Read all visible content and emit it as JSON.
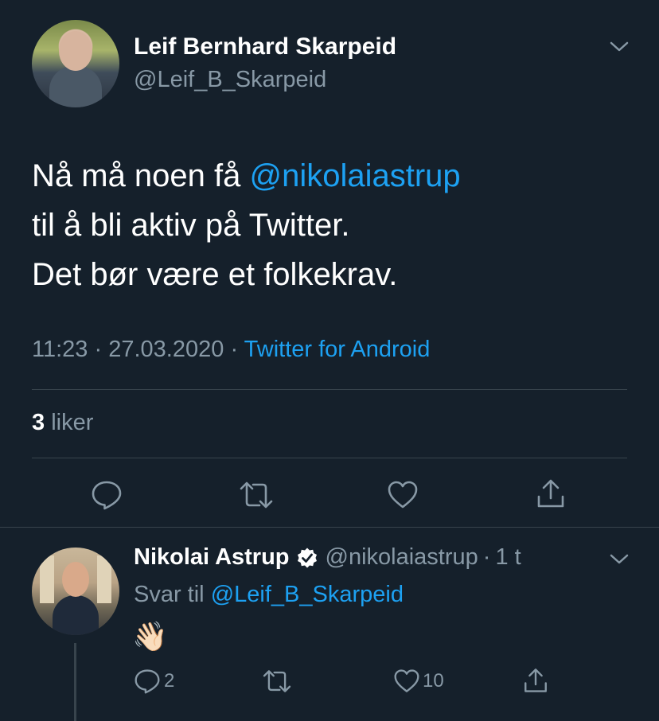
{
  "tweet": {
    "author_name": "Leif Bernhard Skarpeid",
    "author_handle": "@Leif_B_Skarpeid",
    "text_line1": "Nå må noen få ",
    "mention": "@nikolaiastrup",
    "text_line2": "til å bli aktiv på Twitter.",
    "text_line3": "Det bør være et folkekrav.",
    "time": "11:23",
    "sep": "·",
    "date": "27.03.2020",
    "source": "Twitter for Android",
    "likes_count": "3",
    "likes_label": "liker"
  },
  "reply": {
    "author_name": "Nikolai Astrup",
    "author_handle": "@nikolaiastrup",
    "time_ago": "1 t",
    "reply_prefix": "Svar til",
    "reply_to": "@Leif_B_Skarpeid",
    "emoji": "👋🏻",
    "reply_count": "2",
    "like_count": "10"
  },
  "colors": {
    "background": "#15202b",
    "accent": "#1da1f2",
    "muted": "#8899a6",
    "divider": "#38444d"
  }
}
